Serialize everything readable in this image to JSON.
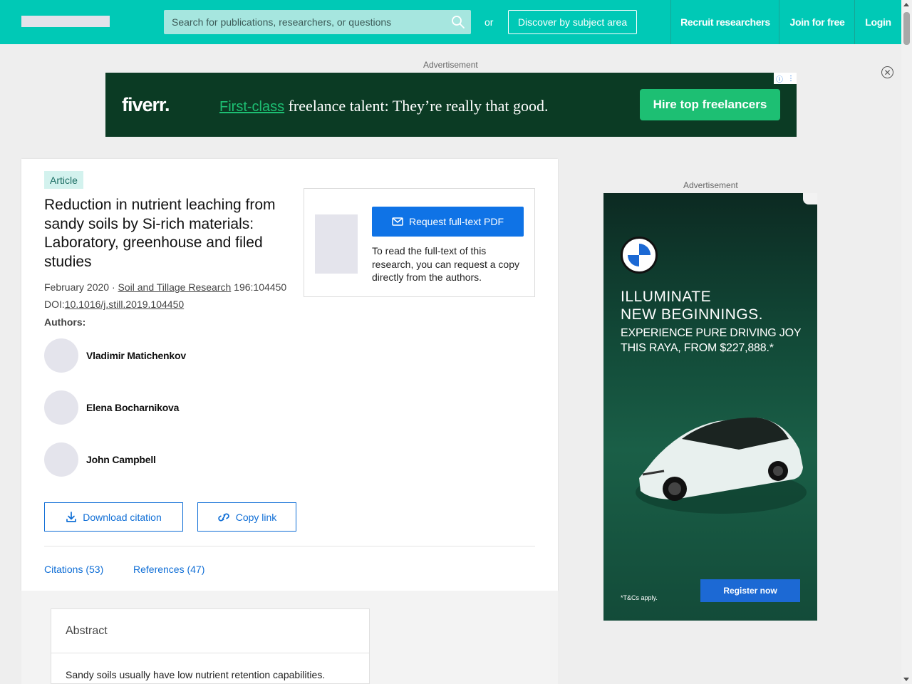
{
  "header": {
    "search_placeholder": "Search for publications, researchers, or questions",
    "or_label": "or",
    "discover_label": "Discover by subject area",
    "nav": [
      "Recruit researchers",
      "Join for free",
      "Login"
    ]
  },
  "ads": {
    "top_label": "Advertisement",
    "side_label": "Advertisement",
    "fiverr": {
      "logo": "fiverr.",
      "tagline_highlight": "First-class",
      "tagline_rest": " freelance talent: They’re really that good.",
      "cta": "Hire top freelancers"
    },
    "bmw": {
      "headline_1": "ILLUMINATE",
      "headline_2": "NEW BEGINNINGS.",
      "sub_1": "EXPERIENCE PURE DRIVING JOY",
      "sub_2": "THIS RAYA, FROM $227,888.*",
      "cta": "Register now",
      "tcs": "*T&Cs apply."
    }
  },
  "article": {
    "badge": "Article",
    "title": "Reduction in nutrient leaching from sandy soils by Si-rich materials: Laboratory, greenhouse and filed studies",
    "date": "February 2020",
    "separator": " · ",
    "journal": "Soil and Tillage Research",
    "volume": " 196:104450",
    "doi_prefix": "DOI:",
    "doi": "10.1016/j.still.2019.104450",
    "authors_label": "Authors:",
    "authors": [
      "Vladimir Matichenkov",
      "Elena Bocharnikova",
      "John Campbell"
    ],
    "download_citation": "Download citation",
    "copy_link": "Copy link",
    "tabs": [
      "Citations (53)",
      "References (47)"
    ]
  },
  "request": {
    "button": "Request full-text PDF",
    "text": "To read the full-text of this research, you can request a copy directly from the authors."
  },
  "abstract": {
    "title": "Abstract",
    "text": "Sandy soils usually have low nutrient retention capabilities."
  },
  "colors": {
    "header": "#00c9b6",
    "link": "#0f6ed6",
    "primary_button": "#0f73e6",
    "fiverr_green": "#1dbf73"
  }
}
